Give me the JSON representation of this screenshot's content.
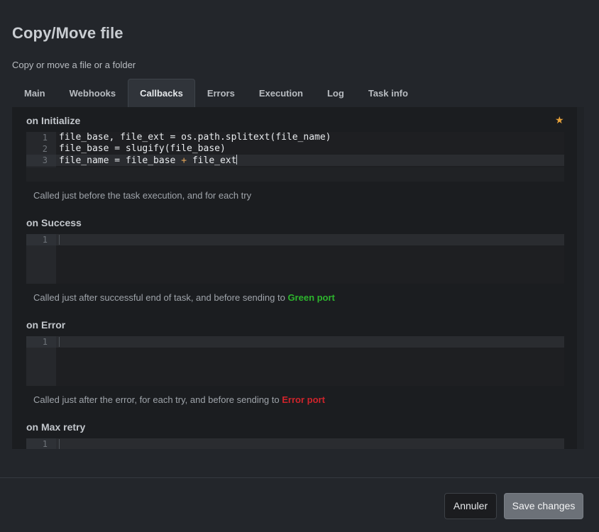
{
  "dialog": {
    "title": "Copy/Move file",
    "subtitle": "Copy or move a file or a folder"
  },
  "tabs": [
    {
      "label": "Main",
      "active": false
    },
    {
      "label": "Webhooks",
      "active": false
    },
    {
      "label": "Callbacks",
      "active": true
    },
    {
      "label": "Errors",
      "active": false
    },
    {
      "label": "Execution",
      "active": false
    },
    {
      "label": "Log",
      "active": false
    },
    {
      "label": "Task info",
      "active": false
    }
  ],
  "favorite_icon": "star-icon",
  "sections": {
    "on_initialize": {
      "title": "on Initialize",
      "lines": [
        {
          "num": "1",
          "code": "file_base, file_ext = os.path.splitext(file_name)"
        },
        {
          "num": "2",
          "code": "file_base = slugify(file_base)"
        },
        {
          "num": "3",
          "code_before_op": "file_name = file_base ",
          "op": "+",
          "code_after_op": " file_ext"
        }
      ],
      "help": "Called just before the task execution, and for each try"
    },
    "on_success": {
      "title": "on Success",
      "line_num": "1",
      "help_prefix": "Called just after successful end of task, and before sending to ",
      "help_port": "Green port",
      "port_color": "#2db52d"
    },
    "on_error": {
      "title": "on Error",
      "line_num": "1",
      "help_prefix": "Called just after the error, for each try, and before sending to ",
      "help_port": "Error port",
      "port_color": "#d0242b"
    },
    "on_max_retry": {
      "title": "on Max retry",
      "line_num": "1"
    }
  },
  "footer": {
    "cancel_label": "Annuler",
    "save_label": "Save changes"
  }
}
